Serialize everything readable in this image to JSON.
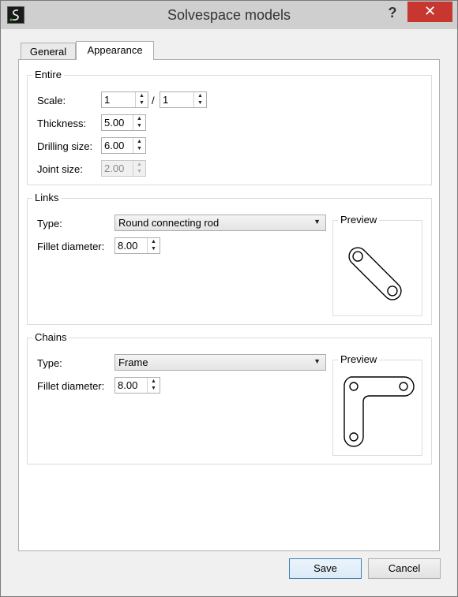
{
  "window": {
    "title": "Solvespace models",
    "help": "?",
    "close": "✕"
  },
  "tabs": [
    {
      "label": "General"
    },
    {
      "label": "Appearance"
    }
  ],
  "entire": {
    "title": "Entire",
    "scale_label": "Scale:",
    "scale_num": "1",
    "scale_sep": "/",
    "scale_den": "1",
    "thickness_label": "Thickness:",
    "thickness": "5.00",
    "drilling_label": "Drilling size:",
    "drilling": "6.00",
    "joint_label": "Joint size:",
    "joint": "2.00"
  },
  "links": {
    "title": "Links",
    "type_label": "Type:",
    "type_value": "Round connecting rod",
    "fillet_label": "Fillet diameter:",
    "fillet": "8.00",
    "preview_label": "Preview"
  },
  "chains": {
    "title": "Chains",
    "type_label": "Type:",
    "type_value": "Frame",
    "fillet_label": "Fillet diameter:",
    "fillet": "8.00",
    "preview_label": "Preview"
  },
  "buttons": {
    "save": "Save",
    "cancel": "Cancel"
  },
  "icons": {
    "app": "solvespace-logo-icon",
    "spin_up": "▲",
    "spin_down": "▼",
    "combo": "▼"
  }
}
